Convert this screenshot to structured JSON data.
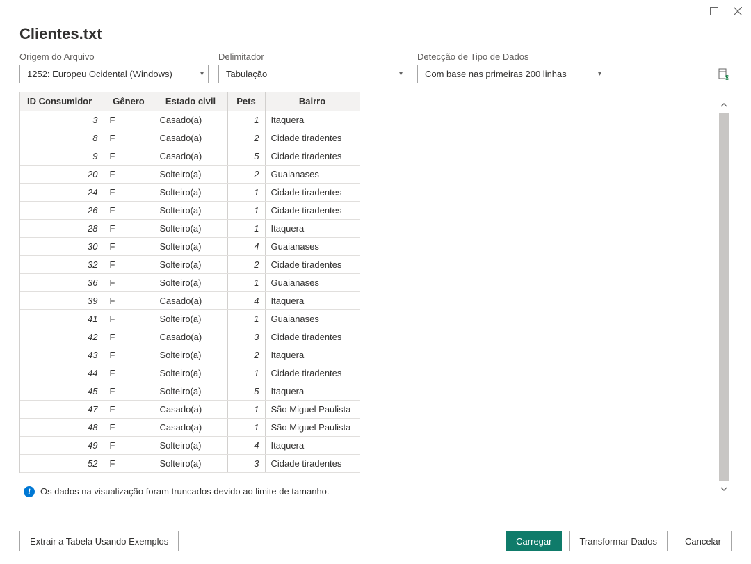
{
  "window": {
    "title": "Clientes.txt"
  },
  "controls": {
    "origin_label": "Origem do Arquivo",
    "origin_value": "1252: Europeu Ocidental (Windows)",
    "delimiter_label": "Delimitador",
    "delimiter_value": "Tabulação",
    "detection_label": "Detecção de Tipo de Dados",
    "detection_value": "Com base nas primeiras 200 linhas"
  },
  "table": {
    "columns": [
      "ID Consumidor",
      "Gênero",
      "Estado civil",
      "Pets",
      "Bairro"
    ],
    "rows": [
      {
        "id": "3",
        "genero": "F",
        "estado": "Casado(a)",
        "pets": "1",
        "bairro": "Itaquera"
      },
      {
        "id": "8",
        "genero": "F",
        "estado": "Casado(a)",
        "pets": "2",
        "bairro": "Cidade tiradentes"
      },
      {
        "id": "9",
        "genero": "F",
        "estado": "Casado(a)",
        "pets": "5",
        "bairro": "Cidade tiradentes"
      },
      {
        "id": "20",
        "genero": "F",
        "estado": "Solteiro(a)",
        "pets": "2",
        "bairro": "Guaianases"
      },
      {
        "id": "24",
        "genero": "F",
        "estado": "Solteiro(a)",
        "pets": "1",
        "bairro": "Cidade tiradentes"
      },
      {
        "id": "26",
        "genero": "F",
        "estado": "Solteiro(a)",
        "pets": "1",
        "bairro": "Cidade tiradentes"
      },
      {
        "id": "28",
        "genero": "F",
        "estado": "Solteiro(a)",
        "pets": "1",
        "bairro": "Itaquera"
      },
      {
        "id": "30",
        "genero": "F",
        "estado": "Solteiro(a)",
        "pets": "4",
        "bairro": "Guaianases"
      },
      {
        "id": "32",
        "genero": "F",
        "estado": "Solteiro(a)",
        "pets": "2",
        "bairro": "Cidade tiradentes"
      },
      {
        "id": "36",
        "genero": "F",
        "estado": "Solteiro(a)",
        "pets": "1",
        "bairro": "Guaianases"
      },
      {
        "id": "39",
        "genero": "F",
        "estado": "Casado(a)",
        "pets": "4",
        "bairro": "Itaquera"
      },
      {
        "id": "41",
        "genero": "F",
        "estado": "Solteiro(a)",
        "pets": "1",
        "bairro": "Guaianases"
      },
      {
        "id": "42",
        "genero": "F",
        "estado": "Casado(a)",
        "pets": "3",
        "bairro": "Cidade tiradentes"
      },
      {
        "id": "43",
        "genero": "F",
        "estado": "Solteiro(a)",
        "pets": "2",
        "bairro": "Itaquera"
      },
      {
        "id": "44",
        "genero": "F",
        "estado": "Solteiro(a)",
        "pets": "1",
        "bairro": "Cidade tiradentes"
      },
      {
        "id": "45",
        "genero": "F",
        "estado": "Solteiro(a)",
        "pets": "5",
        "bairro": "Itaquera"
      },
      {
        "id": "47",
        "genero": "F",
        "estado": "Casado(a)",
        "pets": "1",
        "bairro": "São Miguel Paulista"
      },
      {
        "id": "48",
        "genero": "F",
        "estado": "Casado(a)",
        "pets": "1",
        "bairro": "São Miguel Paulista"
      },
      {
        "id": "49",
        "genero": "F",
        "estado": "Solteiro(a)",
        "pets": "4",
        "bairro": "Itaquera"
      },
      {
        "id": "52",
        "genero": "F",
        "estado": "Solteiro(a)",
        "pets": "3",
        "bairro": "Cidade tiradentes"
      }
    ]
  },
  "info": {
    "message": "Os dados na visualização foram truncados devido ao limite de tamanho."
  },
  "footer": {
    "extract_label": "Extrair a Tabela Usando Exemplos",
    "load_label": "Carregar",
    "transform_label": "Transformar Dados",
    "cancel_label": "Cancelar"
  }
}
